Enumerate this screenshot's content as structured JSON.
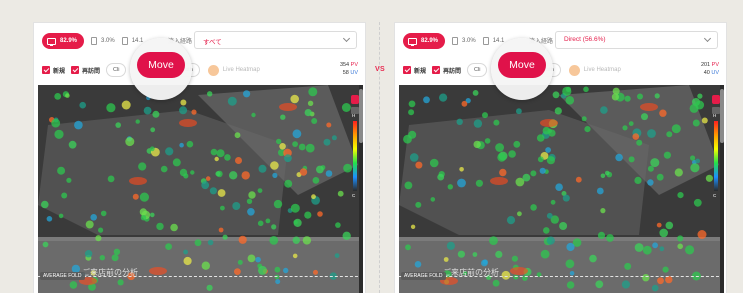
{
  "vs_label": "VS",
  "left": {
    "device_pct": "82.9%",
    "device2_pct": "3.0%",
    "device3_pct": "14.1",
    "filter_label": "流入経路",
    "select_value": "すべて",
    "check_new": "新規",
    "check_return": "再訪問",
    "chip_click": "Cli",
    "chip_path": "Path",
    "live_label": "Live Heatmap",
    "pv": "354",
    "pv_unit": "PV",
    "uv": "58",
    "uv_unit": "UV",
    "fold_label": "AVERAGE FOLD",
    "caption": "ご来店前の分析",
    "move_label": "Move"
  },
  "right": {
    "device_pct": "82.9%",
    "device2_pct": "3.0%",
    "device3_pct": "14.1",
    "filter_label": "流入経路",
    "select_value": "Direct (56.6%)",
    "check_new": "新規",
    "check_return": "再訪問",
    "chip_click": "Cli",
    "chip_path": "Path",
    "live_label": "Live Heatmap",
    "pv": "201",
    "pv_unit": "PV",
    "uv": "40",
    "uv_unit": "UV",
    "fold_label": "AVERAGE FOLD",
    "caption": "ご来店前の分析",
    "move_label": "Move"
  },
  "legend": {
    "high": "H",
    "low": "C"
  },
  "colors": {
    "accent": "#e51c49",
    "uv": "#3a78d8"
  }
}
